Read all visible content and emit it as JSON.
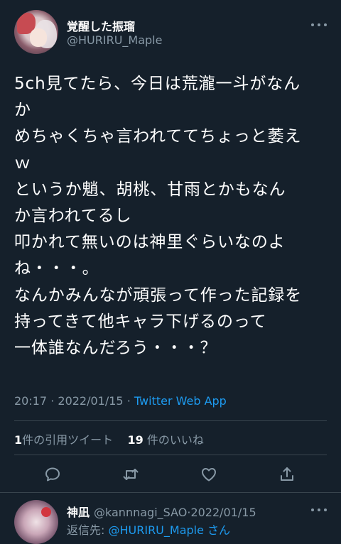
{
  "tweet": {
    "author": {
      "display_name": "覚醒した振瑠",
      "handle": "@HURIRU_Maple"
    },
    "lines": [
      "5ch見てたら、今日は荒瀧一斗がなん",
      "か",
      "めちゃくちゃ言われててちょっと萎え",
      "ｗ",
      "というか魈、胡桃、甘雨とかもなん",
      "か言われてるし",
      "叩かれて無いのは神里ぐらいなのよ",
      "ね・・・。",
      "なんかみんなが頑張って作った記録を",
      "持ってきて他キャラ下げるのって",
      "一体誰なんだろう・・・？"
    ],
    "time": "20:17",
    "date": "2022/01/15",
    "sep": "·",
    "app": "Twitter Web App",
    "quote_count": "1",
    "quote_label": "件の引用ツイート",
    "like_count": "19",
    "like_label": "件のいいね"
  },
  "actions": [
    {
      "icon": "reply-icon"
    },
    {
      "icon": "retweet-icon"
    },
    {
      "icon": "like-icon"
    },
    {
      "icon": "share-icon"
    }
  ],
  "reply": {
    "display_name": "神凪",
    "handle": "@kannnagi_SAO",
    "sep": "·",
    "date": "2022/01/15",
    "replying_label": "返信先: ",
    "replying_to": "@HURIRU_Maple",
    "replying_suffix": "さん"
  },
  "colors": {
    "background": "#15202b",
    "muted": "#8899a6",
    "accent": "#1d9bf0",
    "divider": "#38444d"
  }
}
